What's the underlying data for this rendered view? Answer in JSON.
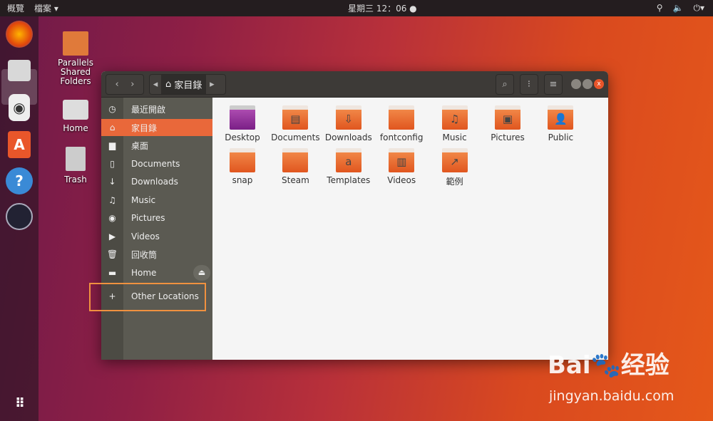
{
  "topbar": {
    "activities": "概覽",
    "app_menu": "檔案 ▾",
    "clock": "星期三 12：06 ●",
    "tray": [
      "network-icon",
      "volume-icon",
      "power-icon"
    ]
  },
  "dock": [
    "firefox",
    "files",
    "rhythmbox",
    "software",
    "help",
    "steam",
    "show-apps"
  ],
  "desktop_icons": [
    "Parallels Shared Folders",
    "Home",
    "Trash"
  ],
  "window": {
    "path": "家目錄",
    "sidebar": [
      {
        "icon": "recent-icon",
        "glyph": "◷",
        "label": "最近開啟"
      },
      {
        "icon": "home-icon",
        "glyph": "⌂",
        "label": "家目錄",
        "active": true
      },
      {
        "icon": "folder-icon",
        "glyph": "▆",
        "label": "桌面"
      },
      {
        "icon": "document-icon",
        "glyph": "▯",
        "label": "Documents"
      },
      {
        "icon": "download-icon",
        "glyph": "↓",
        "label": "Downloads"
      },
      {
        "icon": "music-icon",
        "glyph": "♫",
        "label": "Music"
      },
      {
        "icon": "camera-icon",
        "glyph": "◉",
        "label": "Pictures"
      },
      {
        "icon": "video-icon",
        "glyph": "▶",
        "label": "Videos"
      },
      {
        "icon": "trash-icon",
        "glyph": "🗑",
        "label": "回收筒"
      },
      {
        "icon": "drive-icon",
        "glyph": "▬",
        "label": "Home"
      },
      {
        "icon": "plus-icon",
        "glyph": "+",
        "label": "Other Locations"
      }
    ],
    "files": [
      {
        "name": "Desktop",
        "glyph": ""
      },
      {
        "name": "Documents",
        "glyph": "▤"
      },
      {
        "name": "Downloads",
        "glyph": "⇩"
      },
      {
        "name": "fontconfig",
        "glyph": ""
      },
      {
        "name": "Music",
        "glyph": "♫"
      },
      {
        "name": "Pictures",
        "glyph": "▣"
      },
      {
        "name": "Public",
        "glyph": "👤"
      },
      {
        "name": "snap",
        "glyph": ""
      },
      {
        "name": "Steam",
        "glyph": ""
      },
      {
        "name": "Templates",
        "glyph": "a"
      },
      {
        "name": "Videos",
        "glyph": "▥"
      },
      {
        "name": "範例",
        "glyph": "↗"
      }
    ]
  },
  "watermark": {
    "logo": "Bai 经验",
    "url": "jingyan.baidu.com"
  }
}
